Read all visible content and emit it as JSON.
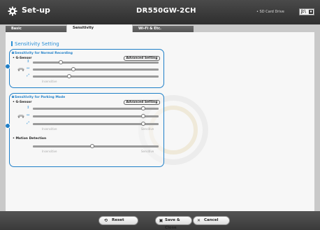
{
  "header": {
    "title": "Set-up",
    "model": "DR550GW-2CH",
    "sd_label": "• SD Card Drive",
    "sd_drive_value": "J:\\"
  },
  "tabs": [
    {
      "label": "Basic",
      "active": false
    },
    {
      "label": "Sensitivity",
      "active": true
    },
    {
      "label": "Wi-Fi & Etc.",
      "active": false
    }
  ],
  "main": {
    "section_title": "Sensitivity Setting",
    "normal": {
      "title": "Sensitivity for Normal Recording",
      "gsensor_label": "• G-Sensor",
      "advanced_label": "Advanced Setting",
      "insensitive": "Insensitive",
      "sensitive": "",
      "sliders": [
        {
          "axis": "z-axis-icon",
          "level": 0.22
        },
        {
          "axis": "y-axis-icon",
          "level": 0.32
        },
        {
          "axis": "x-axis-icon",
          "level": 0.29
        }
      ]
    },
    "parking": {
      "title": "Sensitivity for Parking Mode",
      "gsensor_label": "• G-Sensor",
      "advanced_label": "Advanced Setting",
      "insensitive": "Insensitive",
      "sensitive": "Sensitive",
      "sliders": [
        {
          "axis": "z-axis-icon",
          "level": 0.88
        },
        {
          "axis": "y-axis-icon",
          "level": 0.88
        },
        {
          "axis": "x-axis-icon",
          "level": 0.88
        }
      ],
      "motion_label": "• Motion Detection",
      "motion_insensitive": "Insensitive",
      "motion_sensitive": "Sensitive",
      "motion_level": 0.47
    }
  },
  "footer": {
    "reset_label": "Reset",
    "save_label": "Save & Close",
    "cancel_label": "Cancel"
  },
  "colors": {
    "accent": "#1e7fc8",
    "header_bg": "#3a3a3a",
    "panel_bg": "#f7f7f7"
  }
}
